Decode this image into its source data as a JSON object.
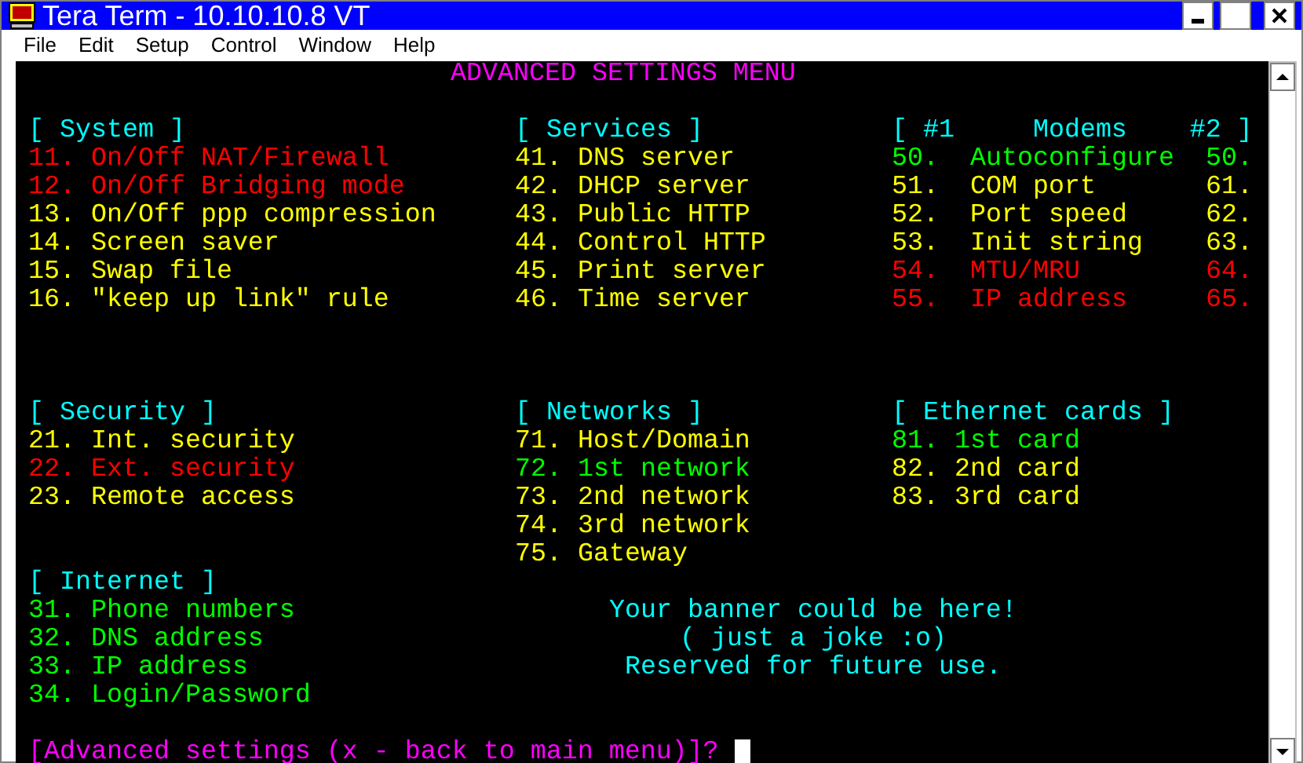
{
  "window": {
    "title": "Tera Term - 10.10.10.8 VT"
  },
  "menu": [
    "File",
    "Edit",
    "Setup",
    "Control",
    "Window",
    "Help"
  ],
  "terminal": {
    "title": "ADVANCED SETTINGS MENU",
    "columns": [
      [
        {
          "heading": "[ System ]",
          "items": [
            {
              "text": "11. On/Off NAT/Firewall",
              "color": "#ff0000"
            },
            {
              "text": "12. On/Off Bridging mode",
              "color": "#ff0000"
            },
            {
              "text": "13. On/Off ppp compression",
              "color": "#ffff00"
            },
            {
              "text": "14. Screen saver",
              "color": "#ffff00"
            },
            {
              "text": "15. Swap file",
              "color": "#ffff00"
            },
            {
              "text": "16. \"keep up link\" rule",
              "color": "#ffff00"
            }
          ]
        },
        {
          "heading": "[ Security ]",
          "items": [
            {
              "text": "21. Int. security",
              "color": "#ffff00"
            },
            {
              "text": "22. Ext. security",
              "color": "#ff0000"
            },
            {
              "text": "23. Remote access",
              "color": "#ffff00"
            }
          ]
        },
        {
          "heading": "[ Internet ]",
          "items": [
            {
              "text": "31. Phone numbers",
              "color": "#00ff00"
            },
            {
              "text": "32. DNS address",
              "color": "#00ff00"
            },
            {
              "text": "33. IP address",
              "color": "#00ff00"
            },
            {
              "text": "34. Login/Password",
              "color": "#00ff00"
            }
          ]
        }
      ],
      [
        {
          "heading": "[ Services ]",
          "items": [
            {
              "text": "41. DNS server",
              "color": "#ffff00"
            },
            {
              "text": "42. DHCP server",
              "color": "#ffff00"
            },
            {
              "text": "43. Public HTTP",
              "color": "#ffff00"
            },
            {
              "text": "44. Control HTTP",
              "color": "#ffff00"
            },
            {
              "text": "45. Print server",
              "color": "#ffff00"
            },
            {
              "text": "46. Time server",
              "color": "#ffff00"
            }
          ]
        },
        {
          "heading": "[ Networks ]",
          "items": [
            {
              "text": "71. Host/Domain",
              "color": "#ffff00"
            },
            {
              "text": "72. 1st network",
              "color": "#00ff00"
            },
            {
              "text": "73. 2nd network",
              "color": "#ffff00"
            },
            {
              "text": "74. 3rd network",
              "color": "#ffff00"
            },
            {
              "text": "75. Gateway",
              "color": "#ffff00"
            }
          ]
        }
      ],
      [
        {
          "heading": "[ #1     Modems    #2 ]",
          "kind": "modems",
          "items": [
            {
              "number": "50.",
              "label": "Autoconfigure",
              "number_2": "50.",
              "color": "#00ff00"
            },
            {
              "number": "51.",
              "label": "COM port",
              "number_2": "61.",
              "color": "#ffff00"
            },
            {
              "number": "52.",
              "label": "Port speed",
              "number_2": "62.",
              "color": "#ffff00"
            },
            {
              "number": "53.",
              "label": "Init string",
              "number_2": "63.",
              "color": "#ffff00"
            },
            {
              "number": "54.",
              "label": "MTU/MRU",
              "number_2": "64.",
              "color": "#ff0000"
            },
            {
              "number": "55.",
              "label": "IP address",
              "number_2": "65.",
              "color": "#ff0000"
            }
          ]
        },
        {
          "heading": "[ Ethernet cards ]",
          "items": [
            {
              "text": "81. 1st card",
              "color": "#00ff00"
            },
            {
              "text": "82. 2nd card",
              "color": "#ffff00"
            },
            {
              "text": "83. 3rd card",
              "color": "#ffff00"
            }
          ]
        }
      ]
    ],
    "banner": [
      "Your banner could be here!",
      "( just a joke :o)",
      "Reserved for future use."
    ],
    "prompt": "[Advanced settings (x - back to main menu)]?"
  }
}
